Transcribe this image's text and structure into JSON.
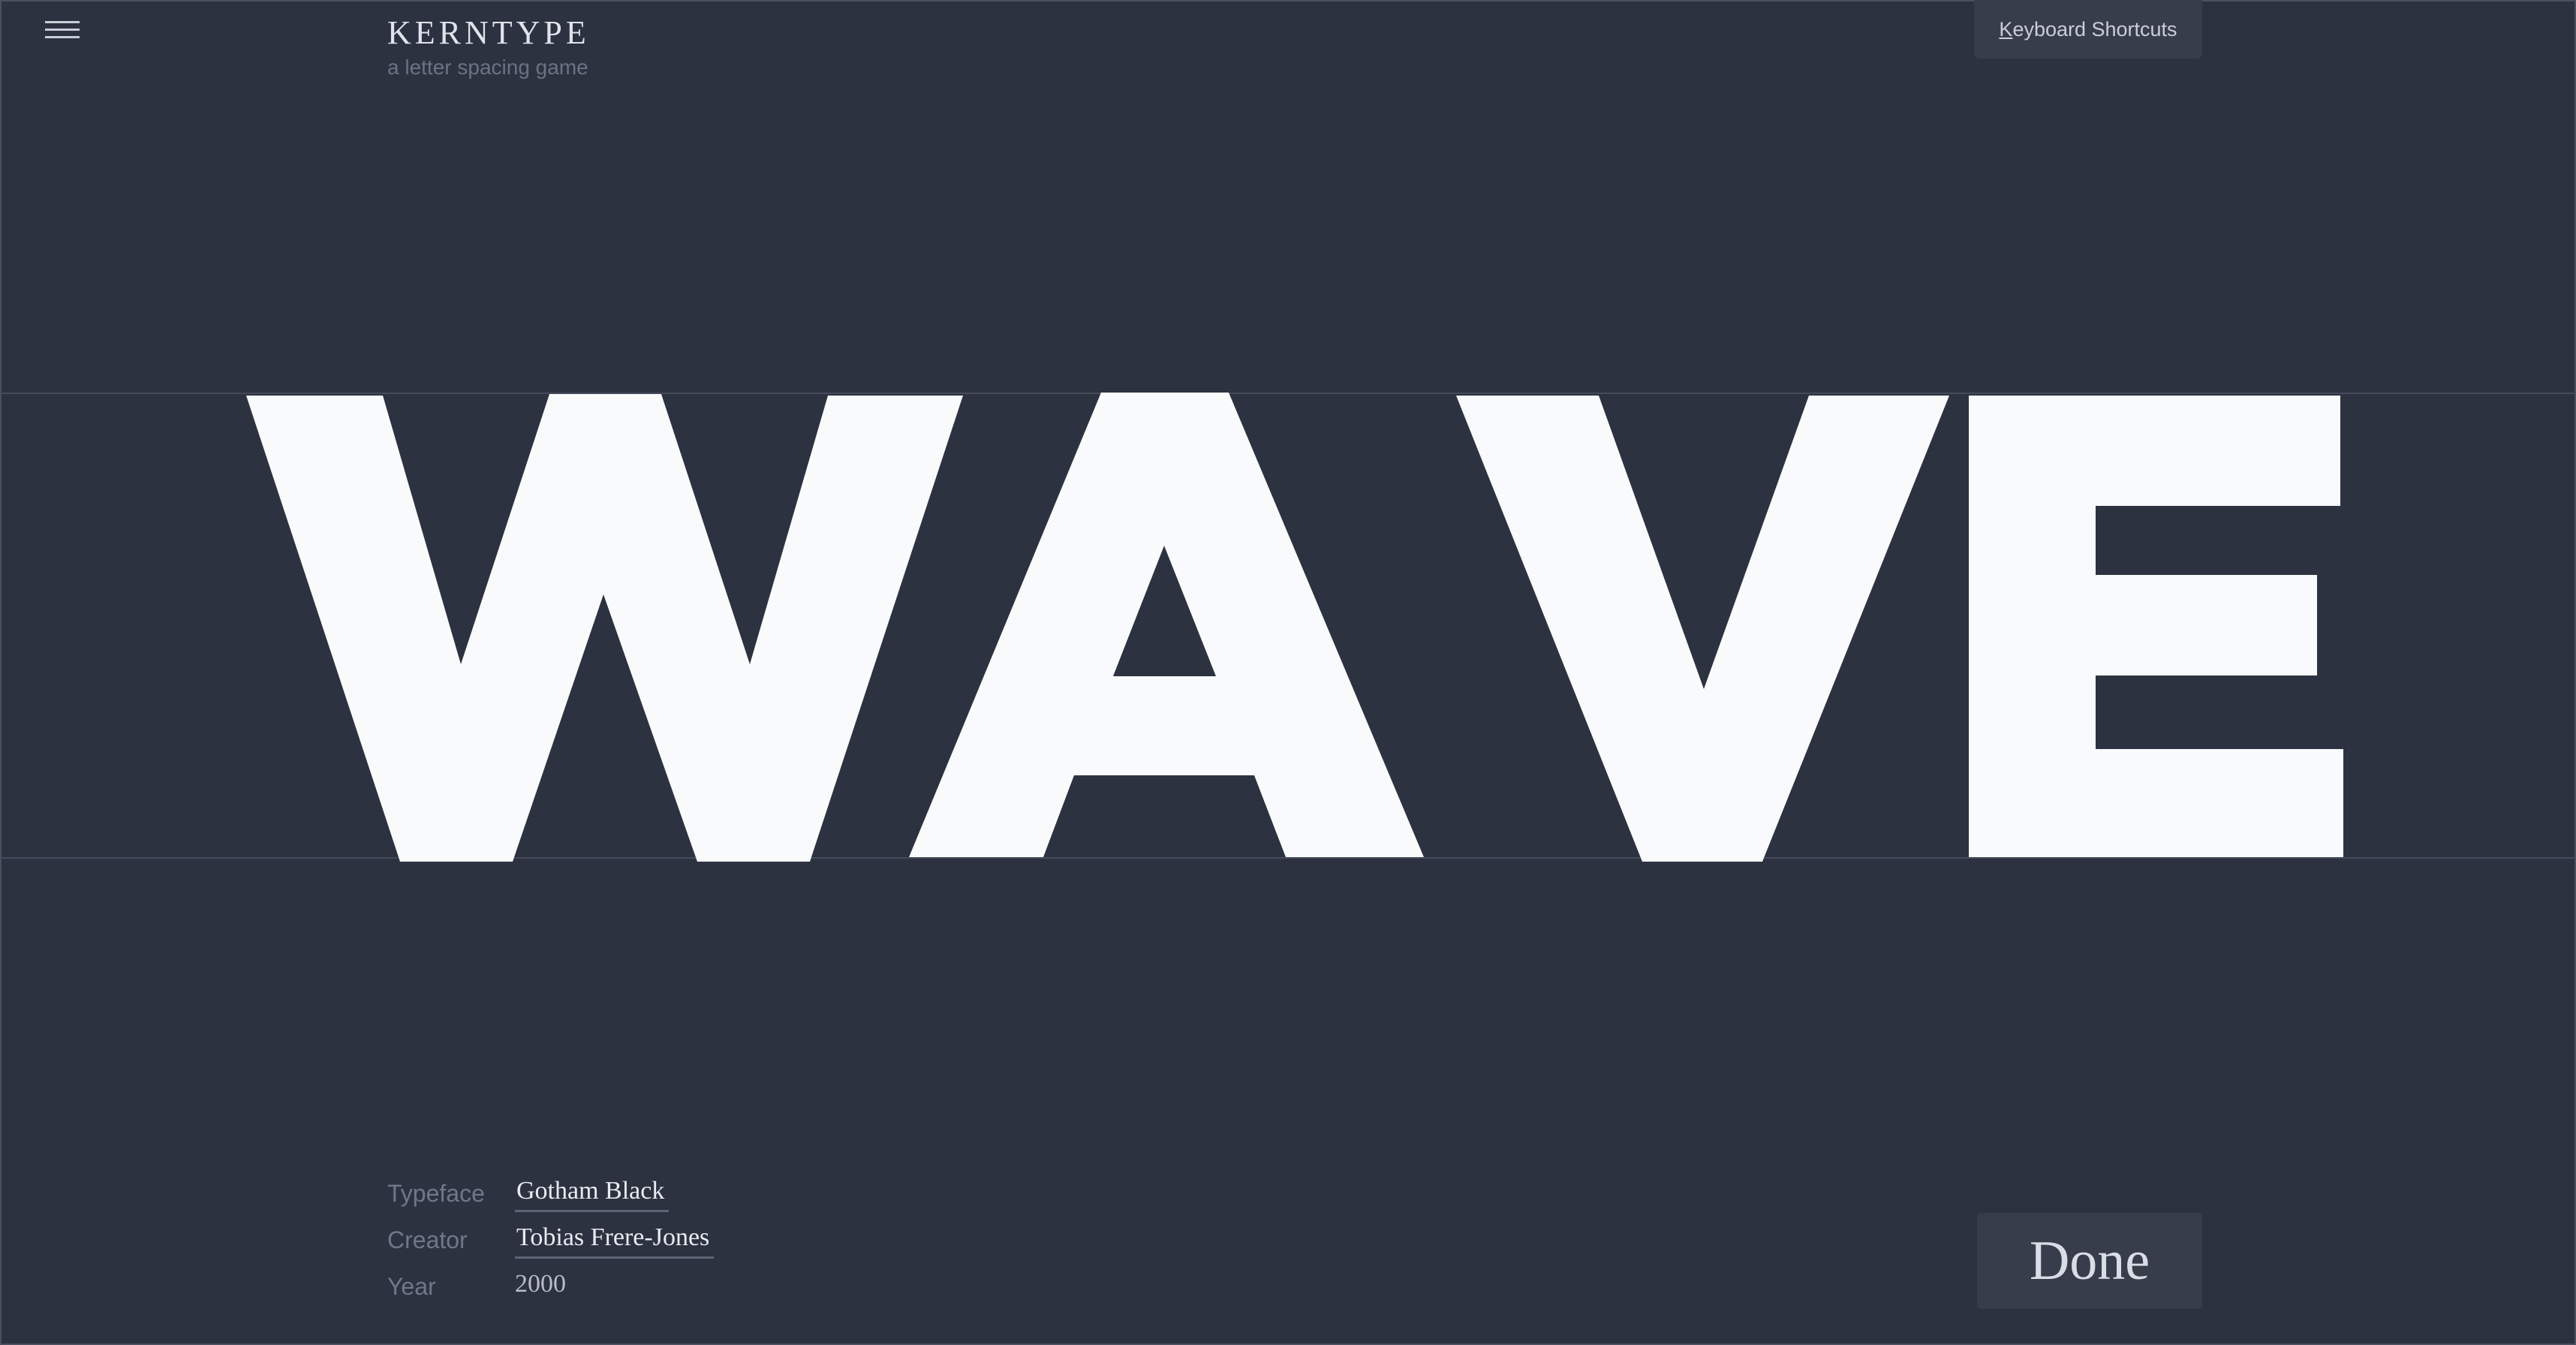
{
  "app": {
    "title": "KERNTYPE",
    "tagline": "a letter spacing game"
  },
  "header": {
    "menu_icon": "hamburger-menu-icon",
    "shortcuts_prefix": "K",
    "shortcuts_rest": "eyboard Shortcuts"
  },
  "word": {
    "letters": [
      "W",
      "A",
      "V",
      "E"
    ],
    "color": "#f8fafc"
  },
  "info": {
    "typeface_label": "Typeface",
    "typeface_value": "Gotham Black",
    "creator_label": "Creator",
    "creator_value": "Tobias Frere-Jones",
    "year_label": "Year",
    "year_value": "2000"
  },
  "actions": {
    "done_label": "Done"
  },
  "colors": {
    "background": "#2d3240",
    "button": "#383d4c",
    "guide": "#454b5b",
    "letter": "#f8fafc"
  }
}
